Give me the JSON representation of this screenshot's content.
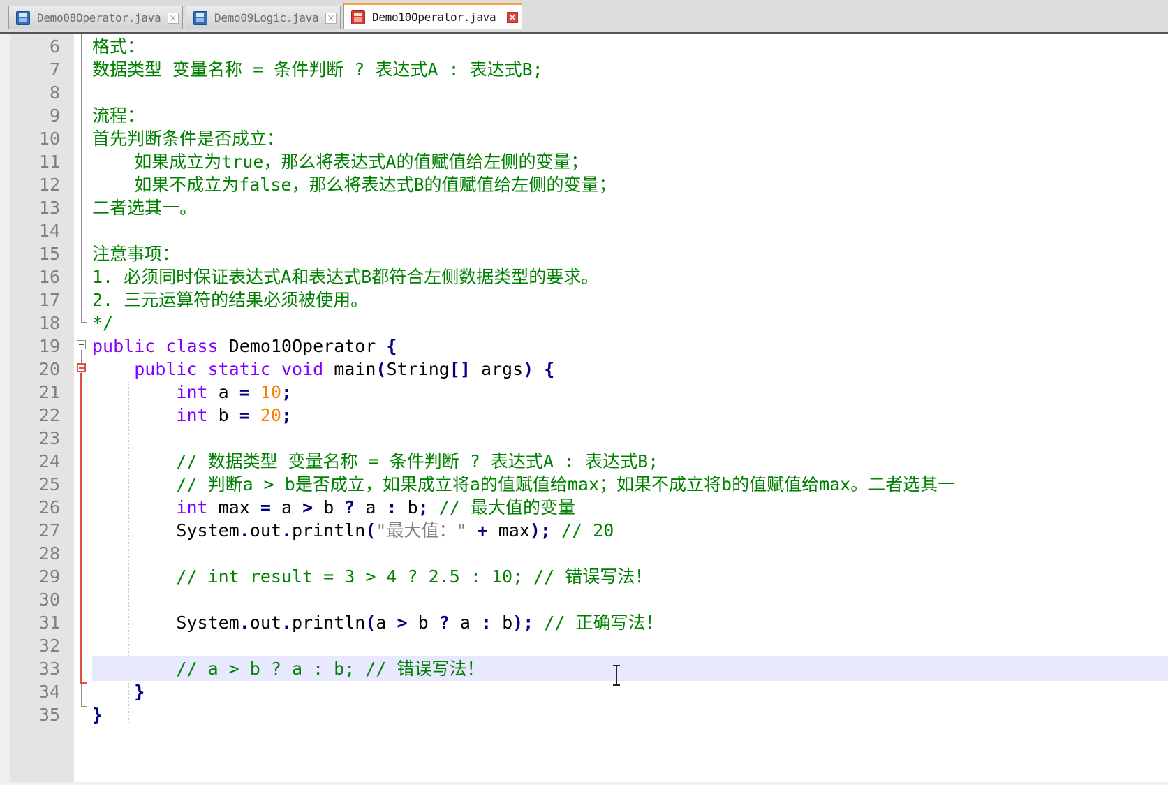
{
  "tabs": [
    {
      "label": "Demo08Operator.java",
      "active": false,
      "close": "×"
    },
    {
      "label": "Demo09Logic.java",
      "active": false,
      "close": "×"
    },
    {
      "label": "Demo10Operator.java",
      "active": true,
      "close": "×"
    }
  ],
  "colors": {
    "comment": "#008000",
    "keyword": "#8000ff",
    "number": "#ff8000",
    "string": "#808080",
    "operator": "#000080",
    "active_tab_accent": "#f6a13a",
    "current_line": "#e8e8ff"
  },
  "editor": {
    "current_line": 33,
    "lines": [
      {
        "n": "6",
        "parts": [
          {
            "t": "格式：",
            "k": "c"
          }
        ]
      },
      {
        "n": "7",
        "parts": [
          {
            "t": "数据类型 变量名称 = 条件判断 ? 表达式A : 表达式B;",
            "k": "c"
          }
        ]
      },
      {
        "n": "8",
        "parts": []
      },
      {
        "n": "9",
        "parts": [
          {
            "t": "流程：",
            "k": "c"
          }
        ]
      },
      {
        "n": "10",
        "parts": [
          {
            "t": "首先判断条件是否成立：",
            "k": "c"
          }
        ]
      },
      {
        "n": "11",
        "parts": [
          {
            "t": "    如果成立为true，那么将表达式A的值赋值给左侧的变量；",
            "k": "c"
          }
        ]
      },
      {
        "n": "12",
        "parts": [
          {
            "t": "    如果不成立为false，那么将表达式B的值赋值给左侧的变量；",
            "k": "c"
          }
        ]
      },
      {
        "n": "13",
        "parts": [
          {
            "t": "二者选其一。",
            "k": "c"
          }
        ]
      },
      {
        "n": "14",
        "parts": []
      },
      {
        "n": "15",
        "parts": [
          {
            "t": "注意事项：",
            "k": "c"
          }
        ]
      },
      {
        "n": "16",
        "parts": [
          {
            "t": "1. 必须同时保证表达式A和表达式B都符合左侧数据类型的要求。",
            "k": "c"
          }
        ]
      },
      {
        "n": "17",
        "parts": [
          {
            "t": "2. 三元运算符的结果必须被使用。",
            "k": "c"
          }
        ]
      },
      {
        "n": "18",
        "parts": [
          {
            "t": "*/",
            "k": "c"
          }
        ]
      },
      {
        "n": "19",
        "parts": [
          {
            "t": "public class",
            "k": "kw"
          },
          {
            "t": " Demo10Operator ",
            "k": ""
          },
          {
            "t": "{",
            "k": "op"
          }
        ]
      },
      {
        "n": "20",
        "parts": [
          {
            "t": "    ",
            "k": ""
          },
          {
            "t": "public static void",
            "k": "kw"
          },
          {
            "t": " main",
            "k": ""
          },
          {
            "t": "(",
            "k": "op"
          },
          {
            "t": "String",
            "k": ""
          },
          {
            "t": "[]",
            "k": "op"
          },
          {
            "t": " args",
            "k": ""
          },
          {
            "t": ")",
            "k": "op"
          },
          {
            "t": " ",
            "k": ""
          },
          {
            "t": "{",
            "k": "op"
          }
        ]
      },
      {
        "n": "21",
        "parts": [
          {
            "t": "        ",
            "k": ""
          },
          {
            "t": "int",
            "k": "kw"
          },
          {
            "t": " a ",
            "k": ""
          },
          {
            "t": "=",
            "k": "op"
          },
          {
            "t": " ",
            "k": ""
          },
          {
            "t": "10",
            "k": "num"
          },
          {
            "t": ";",
            "k": "op"
          }
        ]
      },
      {
        "n": "22",
        "parts": [
          {
            "t": "        ",
            "k": ""
          },
          {
            "t": "int",
            "k": "kw"
          },
          {
            "t": " b ",
            "k": ""
          },
          {
            "t": "=",
            "k": "op"
          },
          {
            "t": " ",
            "k": ""
          },
          {
            "t": "20",
            "k": "num"
          },
          {
            "t": ";",
            "k": "op"
          }
        ]
      },
      {
        "n": "23",
        "parts": []
      },
      {
        "n": "24",
        "parts": [
          {
            "t": "        // 数据类型 变量名称 = 条件判断 ? 表达式A : 表达式B;",
            "k": "c"
          }
        ]
      },
      {
        "n": "25",
        "parts": [
          {
            "t": "        // 判断a > b是否成立，如果成立将a的值赋值给max；如果不成立将b的值赋值给max。二者选其一",
            "k": "c"
          }
        ]
      },
      {
        "n": "26",
        "parts": [
          {
            "t": "        ",
            "k": ""
          },
          {
            "t": "int",
            "k": "kw"
          },
          {
            "t": " max ",
            "k": ""
          },
          {
            "t": "=",
            "k": "op"
          },
          {
            "t": " a ",
            "k": ""
          },
          {
            "t": ">",
            "k": "op"
          },
          {
            "t": " b ",
            "k": ""
          },
          {
            "t": "?",
            "k": "op"
          },
          {
            "t": " a ",
            "k": ""
          },
          {
            "t": ":",
            "k": "op"
          },
          {
            "t": " b",
            "k": ""
          },
          {
            "t": ";",
            "k": "op"
          },
          {
            "t": " // 最大值的变量",
            "k": "c"
          }
        ]
      },
      {
        "n": "27",
        "parts": [
          {
            "t": "        System",
            "k": ""
          },
          {
            "t": ".",
            "k": "op"
          },
          {
            "t": "out",
            "k": ""
          },
          {
            "t": ".",
            "k": "op"
          },
          {
            "t": "println",
            "k": ""
          },
          {
            "t": "(",
            "k": "op"
          },
          {
            "t": "\"最大值：\"",
            "k": "str"
          },
          {
            "t": " ",
            "k": ""
          },
          {
            "t": "+",
            "k": "op"
          },
          {
            "t": " max",
            "k": ""
          },
          {
            "t": ");",
            "k": "op"
          },
          {
            "t": " // 20",
            "k": "c"
          }
        ]
      },
      {
        "n": "28",
        "parts": []
      },
      {
        "n": "29",
        "parts": [
          {
            "t": "        // int result = 3 > 4 ? 2.5 : 10; // 错误写法！",
            "k": "c"
          }
        ]
      },
      {
        "n": "30",
        "parts": []
      },
      {
        "n": "31",
        "parts": [
          {
            "t": "        System",
            "k": ""
          },
          {
            "t": ".",
            "k": "op"
          },
          {
            "t": "out",
            "k": ""
          },
          {
            "t": ".",
            "k": "op"
          },
          {
            "t": "println",
            "k": ""
          },
          {
            "t": "(",
            "k": "op"
          },
          {
            "t": "a ",
            "k": ""
          },
          {
            "t": ">",
            "k": "op"
          },
          {
            "t": " b ",
            "k": ""
          },
          {
            "t": "?",
            "k": "op"
          },
          {
            "t": " a ",
            "k": ""
          },
          {
            "t": ":",
            "k": "op"
          },
          {
            "t": " b",
            "k": ""
          },
          {
            "t": ");",
            "k": "op"
          },
          {
            "t": " // 正确写法！",
            "k": "c"
          }
        ]
      },
      {
        "n": "32",
        "parts": []
      },
      {
        "n": "33",
        "parts": [
          {
            "t": "        // a > b ? a : b; // 错误写法！",
            "k": "c"
          }
        ]
      },
      {
        "n": "34",
        "parts": [
          {
            "t": "    ",
            "k": ""
          },
          {
            "t": "}",
            "k": "op"
          }
        ]
      },
      {
        "n": "35",
        "parts": [
          {
            "t": "}",
            "k": "op"
          }
        ]
      }
    ]
  }
}
